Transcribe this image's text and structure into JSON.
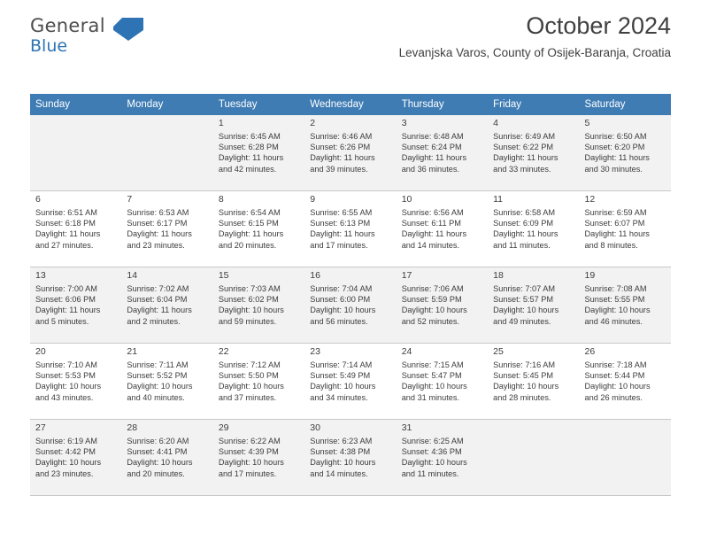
{
  "brand": {
    "name_top": "General",
    "name_bottom": "Blue",
    "flag_icon": "croatia-flag-icon"
  },
  "header": {
    "title": "October 2024",
    "subtitle": "Levanjska Varos, County of Osijek-Baranja, Croatia"
  },
  "colors": {
    "header_row": "#3f7cb4",
    "shaded_row": "#f2f2f2",
    "title_text": "#404040",
    "brand_blue": "#2e74b5"
  },
  "weekdays": [
    "Sunday",
    "Monday",
    "Tuesday",
    "Wednesday",
    "Thursday",
    "Friday",
    "Saturday"
  ],
  "weeks": [
    [
      {
        "day": "",
        "info": ""
      },
      {
        "day": "",
        "info": ""
      },
      {
        "day": "1",
        "info": "Sunrise: 6:45 AM\nSunset: 6:28 PM\nDaylight: 11 hours\nand 42 minutes."
      },
      {
        "day": "2",
        "info": "Sunrise: 6:46 AM\nSunset: 6:26 PM\nDaylight: 11 hours\nand 39 minutes."
      },
      {
        "day": "3",
        "info": "Sunrise: 6:48 AM\nSunset: 6:24 PM\nDaylight: 11 hours\nand 36 minutes."
      },
      {
        "day": "4",
        "info": "Sunrise: 6:49 AM\nSunset: 6:22 PM\nDaylight: 11 hours\nand 33 minutes."
      },
      {
        "day": "5",
        "info": "Sunrise: 6:50 AM\nSunset: 6:20 PM\nDaylight: 11 hours\nand 30 minutes."
      }
    ],
    [
      {
        "day": "6",
        "info": "Sunrise: 6:51 AM\nSunset: 6:18 PM\nDaylight: 11 hours\nand 27 minutes."
      },
      {
        "day": "7",
        "info": "Sunrise: 6:53 AM\nSunset: 6:17 PM\nDaylight: 11 hours\nand 23 minutes."
      },
      {
        "day": "8",
        "info": "Sunrise: 6:54 AM\nSunset: 6:15 PM\nDaylight: 11 hours\nand 20 minutes."
      },
      {
        "day": "9",
        "info": "Sunrise: 6:55 AM\nSunset: 6:13 PM\nDaylight: 11 hours\nand 17 minutes."
      },
      {
        "day": "10",
        "info": "Sunrise: 6:56 AM\nSunset: 6:11 PM\nDaylight: 11 hours\nand 14 minutes."
      },
      {
        "day": "11",
        "info": "Sunrise: 6:58 AM\nSunset: 6:09 PM\nDaylight: 11 hours\nand 11 minutes."
      },
      {
        "day": "12",
        "info": "Sunrise: 6:59 AM\nSunset: 6:07 PM\nDaylight: 11 hours\nand 8 minutes."
      }
    ],
    [
      {
        "day": "13",
        "info": "Sunrise: 7:00 AM\nSunset: 6:06 PM\nDaylight: 11 hours\nand 5 minutes."
      },
      {
        "day": "14",
        "info": "Sunrise: 7:02 AM\nSunset: 6:04 PM\nDaylight: 11 hours\nand 2 minutes."
      },
      {
        "day": "15",
        "info": "Sunrise: 7:03 AM\nSunset: 6:02 PM\nDaylight: 10 hours\nand 59 minutes."
      },
      {
        "day": "16",
        "info": "Sunrise: 7:04 AM\nSunset: 6:00 PM\nDaylight: 10 hours\nand 56 minutes."
      },
      {
        "day": "17",
        "info": "Sunrise: 7:06 AM\nSunset: 5:59 PM\nDaylight: 10 hours\nand 52 minutes."
      },
      {
        "day": "18",
        "info": "Sunrise: 7:07 AM\nSunset: 5:57 PM\nDaylight: 10 hours\nand 49 minutes."
      },
      {
        "day": "19",
        "info": "Sunrise: 7:08 AM\nSunset: 5:55 PM\nDaylight: 10 hours\nand 46 minutes."
      }
    ],
    [
      {
        "day": "20",
        "info": "Sunrise: 7:10 AM\nSunset: 5:53 PM\nDaylight: 10 hours\nand 43 minutes."
      },
      {
        "day": "21",
        "info": "Sunrise: 7:11 AM\nSunset: 5:52 PM\nDaylight: 10 hours\nand 40 minutes."
      },
      {
        "day": "22",
        "info": "Sunrise: 7:12 AM\nSunset: 5:50 PM\nDaylight: 10 hours\nand 37 minutes."
      },
      {
        "day": "23",
        "info": "Sunrise: 7:14 AM\nSunset: 5:49 PM\nDaylight: 10 hours\nand 34 minutes."
      },
      {
        "day": "24",
        "info": "Sunrise: 7:15 AM\nSunset: 5:47 PM\nDaylight: 10 hours\nand 31 minutes."
      },
      {
        "day": "25",
        "info": "Sunrise: 7:16 AM\nSunset: 5:45 PM\nDaylight: 10 hours\nand 28 minutes."
      },
      {
        "day": "26",
        "info": "Sunrise: 7:18 AM\nSunset: 5:44 PM\nDaylight: 10 hours\nand 26 minutes."
      }
    ],
    [
      {
        "day": "27",
        "info": "Sunrise: 6:19 AM\nSunset: 4:42 PM\nDaylight: 10 hours\nand 23 minutes."
      },
      {
        "day": "28",
        "info": "Sunrise: 6:20 AM\nSunset: 4:41 PM\nDaylight: 10 hours\nand 20 minutes."
      },
      {
        "day": "29",
        "info": "Sunrise: 6:22 AM\nSunset: 4:39 PM\nDaylight: 10 hours\nand 17 minutes."
      },
      {
        "day": "30",
        "info": "Sunrise: 6:23 AM\nSunset: 4:38 PM\nDaylight: 10 hours\nand 14 minutes."
      },
      {
        "day": "31",
        "info": "Sunrise: 6:25 AM\nSunset: 4:36 PM\nDaylight: 10 hours\nand 11 minutes."
      },
      {
        "day": "",
        "info": ""
      },
      {
        "day": "",
        "info": ""
      }
    ]
  ]
}
